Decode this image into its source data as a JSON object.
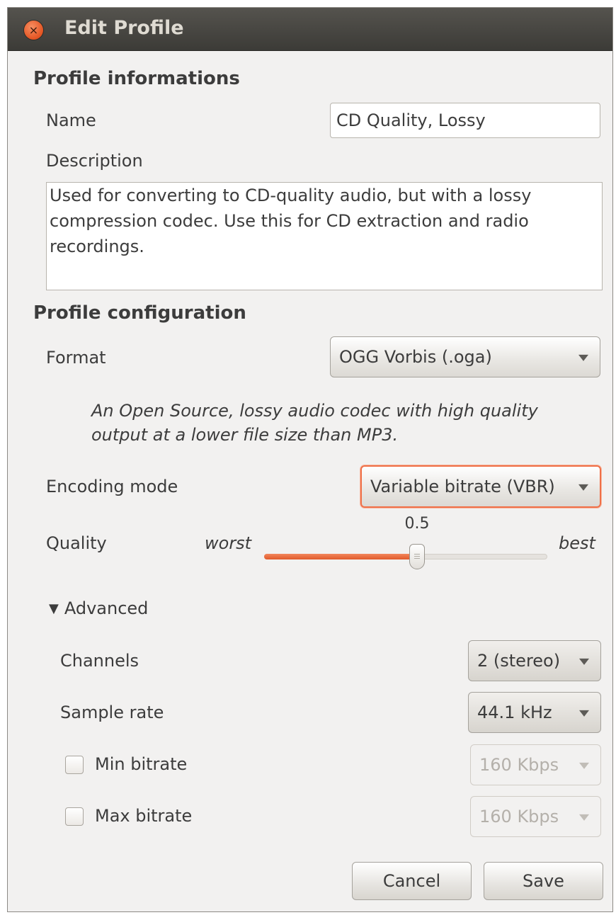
{
  "window": {
    "title": "Edit Profile",
    "close_glyph": "×"
  },
  "profile_info": {
    "section_title": "Profile informations",
    "name_label": "Name",
    "name_value": "CD Quality, Lossy",
    "description_label": "Description",
    "description_value": "Used for converting to CD-quality audio, but with a lossy compression codec. Use this for CD extraction and radio recordings."
  },
  "profile_config": {
    "section_title": "Profile configuration",
    "format_label": "Format",
    "format_value": "OGG Vorbis (.oga)",
    "format_description": "An Open Source, lossy audio codec with high quality output at a lower file size than MP3.",
    "encoding_mode_label": "Encoding mode",
    "encoding_mode_value": "Variable bitrate (VBR)",
    "quality_label": "Quality",
    "quality_min_label": "worst",
    "quality_max_label": "best",
    "quality_value_text": "0.5",
    "quality_fraction": 0.54
  },
  "advanced": {
    "expander_label": "Advanced",
    "expander_glyph": "▼",
    "channels_label": "Channels",
    "channels_value": "2 (stereo)",
    "sample_rate_label": "Sample rate",
    "sample_rate_value": "44.1 kHz",
    "min_bitrate_label": "Min bitrate",
    "min_bitrate_value": "160 Kbps",
    "min_bitrate_checked": false,
    "max_bitrate_label": "Max bitrate",
    "max_bitrate_value": "160 Kbps",
    "max_bitrate_checked": false
  },
  "buttons": {
    "cancel": "Cancel",
    "save": "Save"
  },
  "colors": {
    "accent": "#e05a2a",
    "titlebar": "#3c3b37",
    "window_bg": "#f2f1f0"
  }
}
